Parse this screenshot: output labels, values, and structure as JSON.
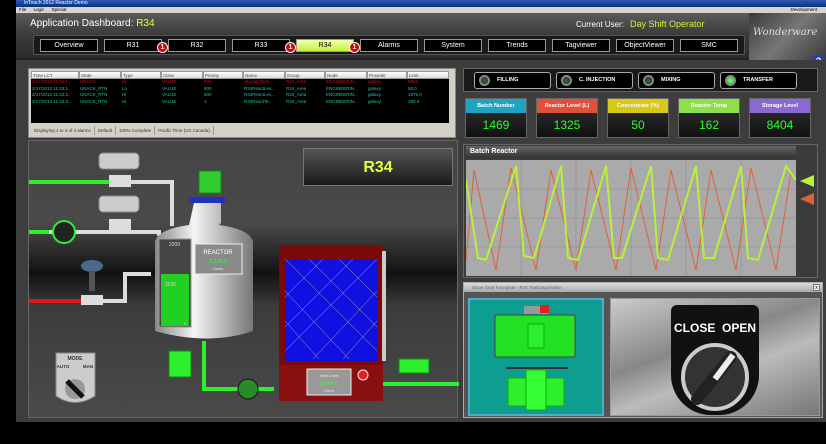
{
  "window": {
    "title": "InTouch 2012 Reactor Demo",
    "menu": [
      "File",
      "Logic",
      "Special"
    ],
    "menu_right": "Development"
  },
  "header": {
    "title_prefix": "Application Dashboard:",
    "title_reactor": "R34",
    "user_label": "Current User:",
    "user_name": "Day Shift Operator",
    "logo": "Wonderware",
    "help": "?"
  },
  "nav": [
    {
      "label": "Overview",
      "badge": null
    },
    {
      "label": "R31",
      "badge": "1"
    },
    {
      "label": "R32",
      "badge": null
    },
    {
      "label": "R33",
      "badge": "1"
    },
    {
      "label": "R34",
      "badge": "1",
      "active": true
    },
    {
      "label": "Alarms"
    },
    {
      "label": "System"
    },
    {
      "label": "Trends"
    },
    {
      "label": "Tagviewer"
    },
    {
      "label": "ObjectViewer"
    },
    {
      "label": "SMC"
    }
  ],
  "alarms": {
    "columns": [
      "Time LCT",
      "State",
      "Type",
      "Class",
      "Priority",
      "Name",
      "Group",
      "Node",
      "Provider",
      "Limit"
    ],
    "rows": [
      [
        "2/17/2012 11:31:1..",
        "UNACK",
        "Hi",
        "VALUE",
        "500",
        "StorageTank...",
        "R34_Area",
        "ENGINEERIN...",
        "galaxy",
        "9999"
      ],
      [
        "2/17/2012 11:33:1..",
        "UNACK_RTN",
        "Lo",
        "VALUE",
        "500",
        "R34ReactLev...",
        "R34_Area",
        "ENGINEERIN...",
        "galaxy",
        "50.0"
      ],
      [
        "2/17/2012 11:34:2..",
        "UNACK_RTN",
        "Hi",
        "VALUE",
        "500",
        "R34ReactLev...",
        "R34_Area",
        "ENGINEERIN...",
        "galaxy",
        "1875.0"
      ],
      [
        "2/17/2012 11:34:3..",
        "UNACK_RTN",
        "Hi",
        "VALUE",
        "1",
        "R34ReactTe...",
        "R34_Area",
        "ENGINEERIN...",
        "galaxy",
        "180.0"
      ]
    ],
    "row_colors": [
      "#c0141e",
      "#1ec8a0",
      "#1ec8a0",
      "#1ec8a0"
    ],
    "status": [
      "Displaying 1 to 4 of 4 alarms",
      "Default",
      "100% Complete",
      "Pacific Time (US  Canada)"
    ]
  },
  "process": {
    "reactor_name": "R34",
    "reactor_label": "REACTOR",
    "reactor_value": "1,325.0",
    "reactor_unit": "Liters",
    "gauge_max": "2200",
    "gauge_mid": "1100",
    "gauge_min": "0",
    "tank_label": "Tank Level",
    "tank_value": "8,404.0",
    "tank_unit": "Liters",
    "mode_label": "MODE",
    "mode_auto": "AUTO",
    "mode_man": "MAN"
  },
  "phases": [
    {
      "label": "FILLING",
      "on": false
    },
    {
      "label": "C. INJECTION",
      "on": false
    },
    {
      "label": "MIXING",
      "on": false
    },
    {
      "label": "TRANSFER",
      "on": true
    }
  ],
  "kpis": [
    {
      "label": "Batch Number",
      "value": "1469",
      "color": "#1fa3c0"
    },
    {
      "label": "Reactor Level (L)",
      "value": "1325",
      "color": "#e0503a"
    },
    {
      "label": "Concentrate (%)",
      "value": "50",
      "color": "#d8c81a"
    },
    {
      "label": "Reactor Temp",
      "value": "162",
      "color": "#8ee04a"
    },
    {
      "label": "Storage Level",
      "value": "8404",
      "color": "#8a6ad0"
    }
  ],
  "trend": {
    "title": "Batch Reactor",
    "colors": {
      "level": "#b8f03a",
      "temp": "#e0603a"
    }
  },
  "popup": {
    "title": "Show Gear Faceplate - R34 ToolOutputValve",
    "switch_text": "CLOSE  OPEN",
    "close": "x"
  }
}
